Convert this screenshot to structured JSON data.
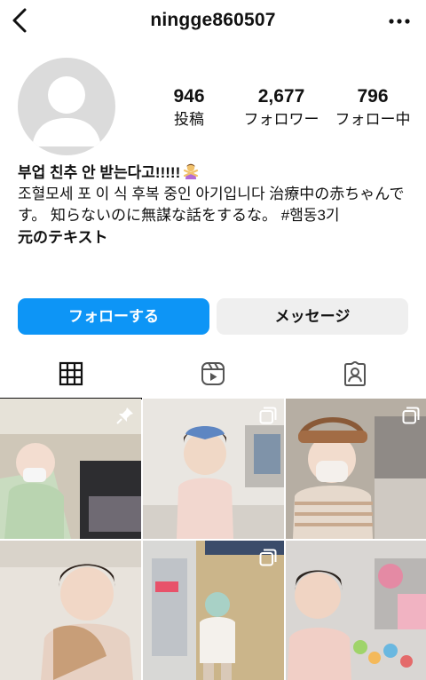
{
  "header": {
    "username": "ningge860507",
    "back_icon": "back-arrow-icon",
    "more_icon": "more-dots-icon"
  },
  "profile": {
    "avatar_icon": "default-avatar-icon",
    "stats": {
      "posts": {
        "count": "946",
        "label": "投稿"
      },
      "followers": {
        "count": "2,677",
        "label": "フォロワー"
      },
      "following": {
        "count": "796",
        "label": "フォロー中"
      }
    },
    "bio": {
      "name": "부업 친추 안 받는다고!!!!!",
      "name_emoji": "person-gesturing-no-emoji",
      "text": "조혈모세 포 이 식 후복 중인 아기입니다 治療中の赤ちゃんです。 知らないのに無謀な話をするな。 #햄동3기",
      "translate_link": "元のテキスト"
    }
  },
  "actions": {
    "follow_label": "フォローする",
    "message_label": "メッセージ"
  },
  "tabs": [
    {
      "icon": "grid-icon",
      "active": true
    },
    {
      "icon": "reels-icon",
      "active": false
    },
    {
      "icon": "tagged-icon",
      "active": false
    }
  ],
  "posts": [
    {
      "badge": "pin-icon"
    },
    {
      "badge": "multi-photo-icon"
    },
    {
      "badge": "multi-photo-icon"
    },
    {
      "badge": "none"
    },
    {
      "badge": "multi-photo-icon"
    },
    {
      "badge": "none"
    }
  ],
  "colors": {
    "accent_blue": "#0d95f6",
    "secondary_button": "#efefef",
    "avatar_gray": "#dbdbdb"
  }
}
